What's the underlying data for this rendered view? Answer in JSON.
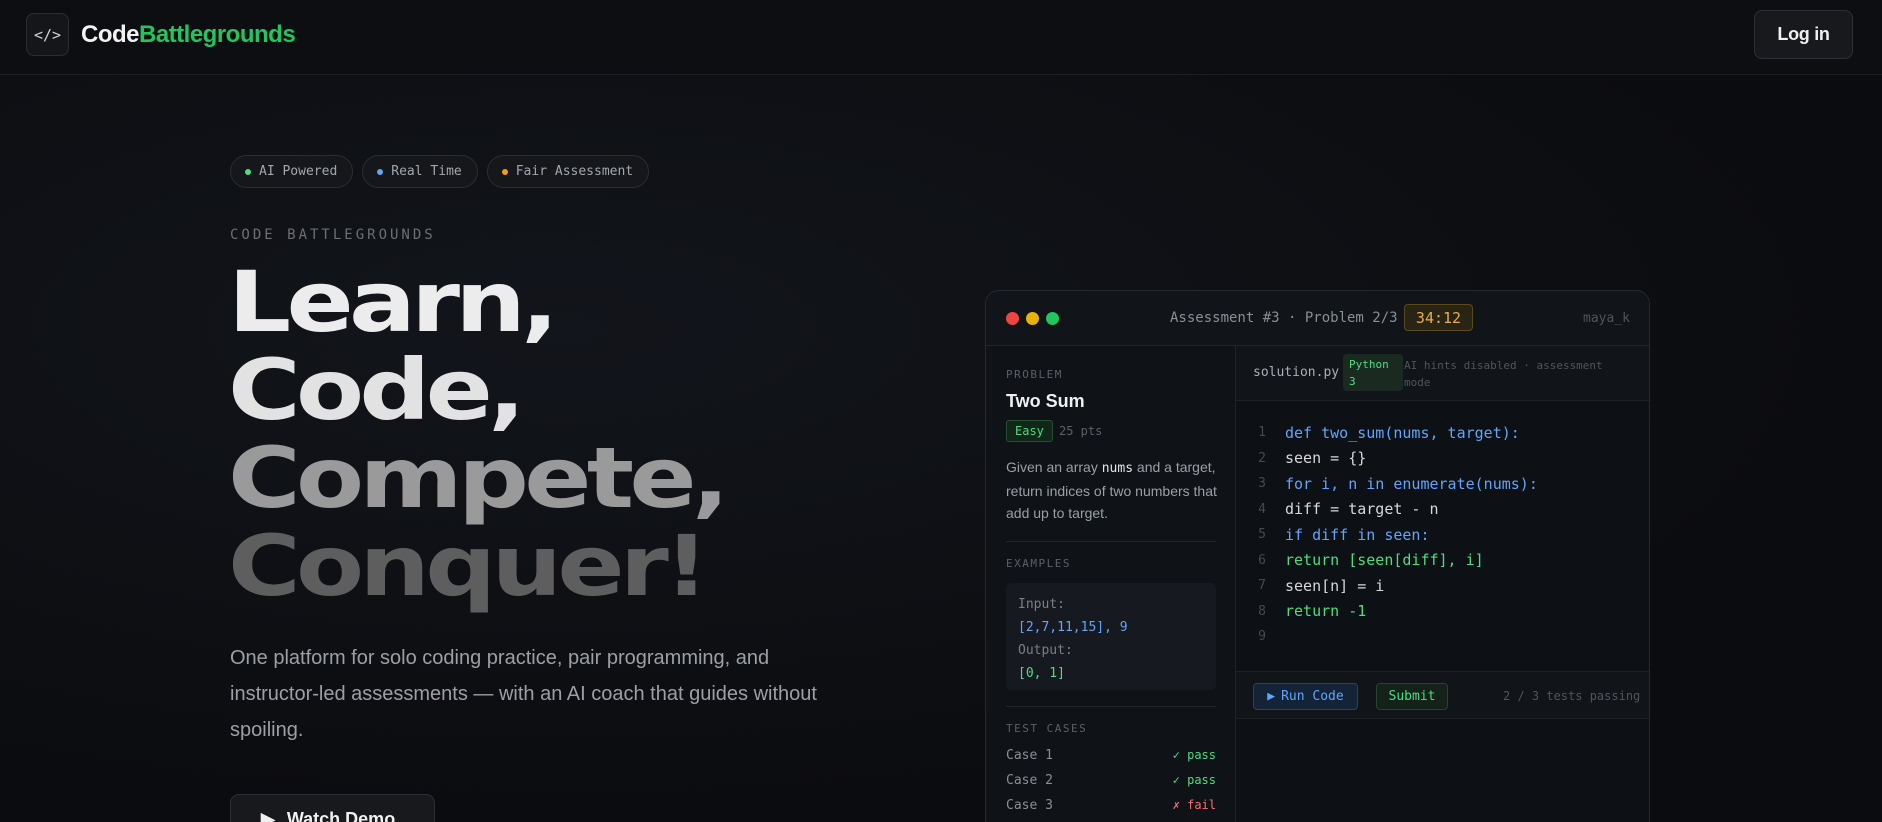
{
  "nav": {
    "logo_glyph": "</>",
    "brand_white": "Code",
    "brand_green": "Battlegrounds",
    "login_label": "Log in"
  },
  "pills": [
    {
      "label": "AI Powered",
      "color": "#4ade80"
    },
    {
      "label": "Real Time",
      "color": "#60a5fa"
    },
    {
      "label": "Fair Assessment",
      "color": "#f59e0b"
    }
  ],
  "hero": {
    "eyebrow": "CODE BATTLEGROUNDS",
    "lines": [
      "Learn,",
      "Code,",
      "Compete,",
      "Conquer!"
    ],
    "subtitle": "One platform for solo coding practice, pair programming, and instructor-led assessments — with an AI coach that guides without spoiling.",
    "demo_label": "Watch Demo"
  },
  "editor": {
    "title": "Assessment #3 · Problem 2/3",
    "timer": "34:12",
    "user": "maya_k",
    "problem": {
      "section": "PROBLEM",
      "title": "Two Sum",
      "difficulty": "Easy",
      "points": "25 pts",
      "desc_pre": "Given an array ",
      "desc_code": "nums",
      "desc_post": " and a target, return indices of two numbers that add up to target."
    },
    "examples": {
      "section": "EXAMPLES",
      "input_label": "Input:",
      "input_value": "[2,7,11,15], 9",
      "output_label": "Output:",
      "output_value": "[0, 1]"
    },
    "tests": {
      "section": "TEST CASES",
      "cases": [
        {
          "name": "Case 1",
          "result": "✓ pass"
        },
        {
          "name": "Case 2",
          "result": "✓ pass"
        },
        {
          "name": "Case 3",
          "result": "✗ fail"
        }
      ]
    },
    "file": {
      "name": "solution.py",
      "lang": "Python 3",
      "hint": "AI hints disabled · assessment mode"
    },
    "code_lines": [
      {
        "n": "1",
        "text": "def two_sum(nums, target):",
        "tone": "blue"
      },
      {
        "n": "2",
        "text": "seen = {}",
        "tone": "white"
      },
      {
        "n": "3",
        "text": "for i, n in enumerate(nums):",
        "tone": "blue"
      },
      {
        "n": "4",
        "text": "diff = target - n",
        "tone": "white"
      },
      {
        "n": "5",
        "text": "if diff in seen:",
        "tone": "blue"
      },
      {
        "n": "6",
        "text": "return [seen[diff], i]",
        "tone": "green"
      },
      {
        "n": "7",
        "text": "seen[n] = i",
        "tone": "white"
      },
      {
        "n": "8",
        "text": "return -1",
        "tone": "green"
      },
      {
        "n": "9",
        "text": "",
        "tone": "white"
      }
    ],
    "run_label": "Run Code",
    "submit_label": "Submit",
    "tests_status": "2 / 3 tests passing"
  }
}
